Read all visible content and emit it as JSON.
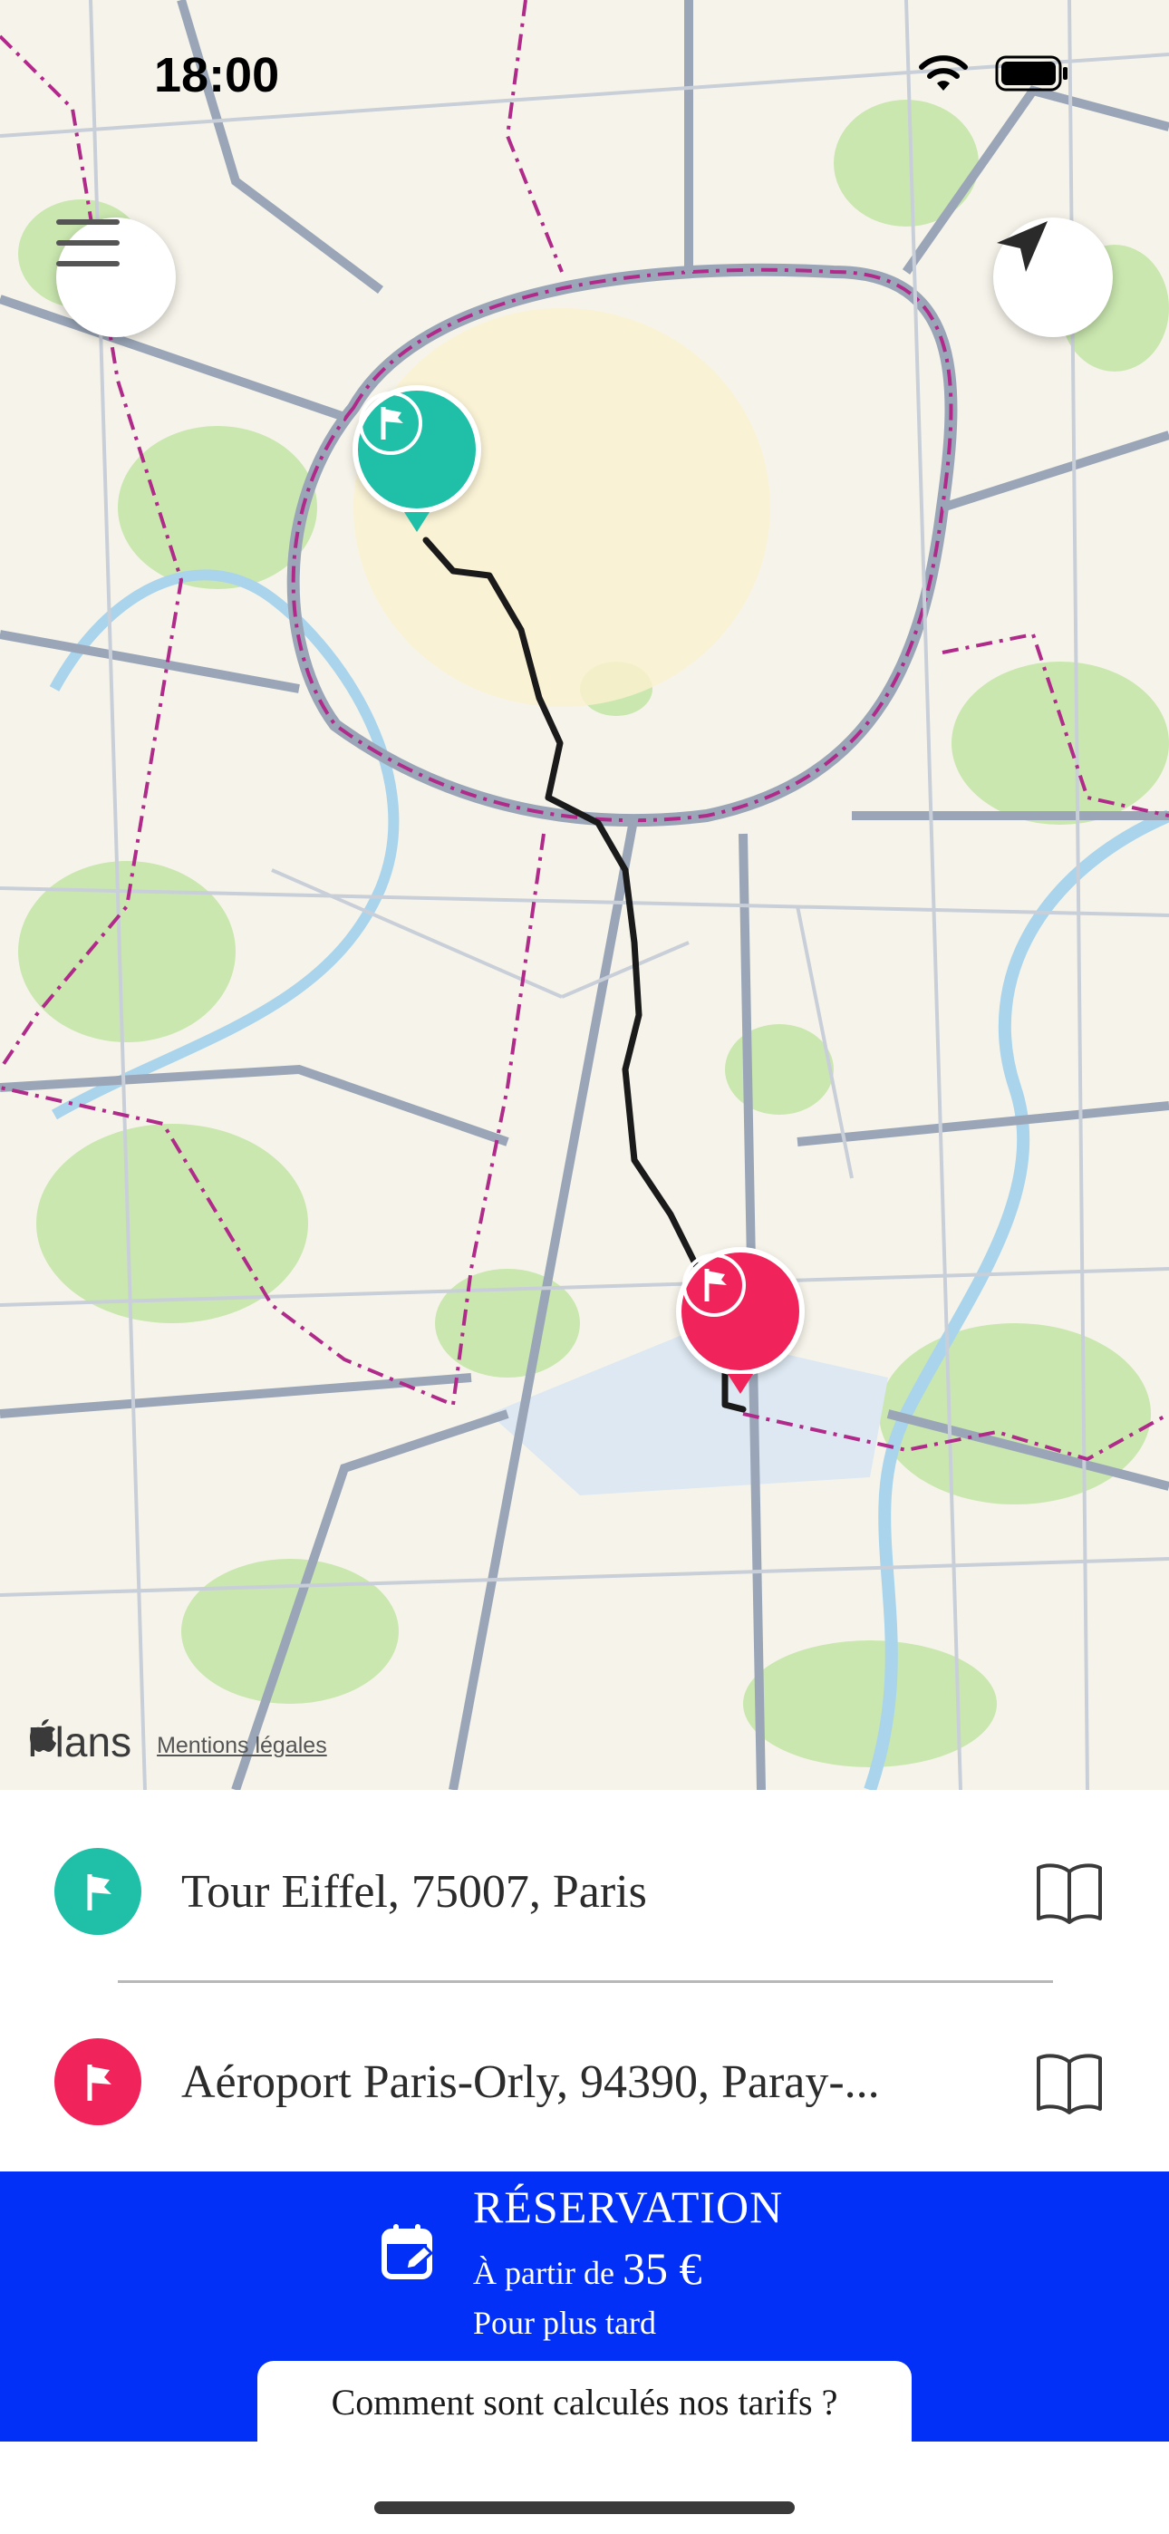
{
  "status_bar": {
    "time": "18:00"
  },
  "map": {
    "attribution_brand": "Plans",
    "attribution_legal": "Mentions légales"
  },
  "route": {
    "origin": {
      "address": "Tour Eiffel, 75007, Paris",
      "color": "#1fbfa8"
    },
    "destination": {
      "address": "Aéroport Paris-Orly, 94390, Paray-...",
      "color": "#f0245a"
    }
  },
  "booking": {
    "title": "RÉSERVATION",
    "price_prefix": "À partir de ",
    "price_amount": "35 €",
    "subtitle": "Pour plus tard",
    "color": "#0330f7"
  },
  "tariff_link": "Comment sont calculés nos tarifs ?",
  "icons": {
    "menu": "hamburger-icon",
    "locate": "location-arrow-icon",
    "book": "address-book-icon",
    "flag": "flag-icon",
    "calendar": "calendar-edit-icon"
  }
}
